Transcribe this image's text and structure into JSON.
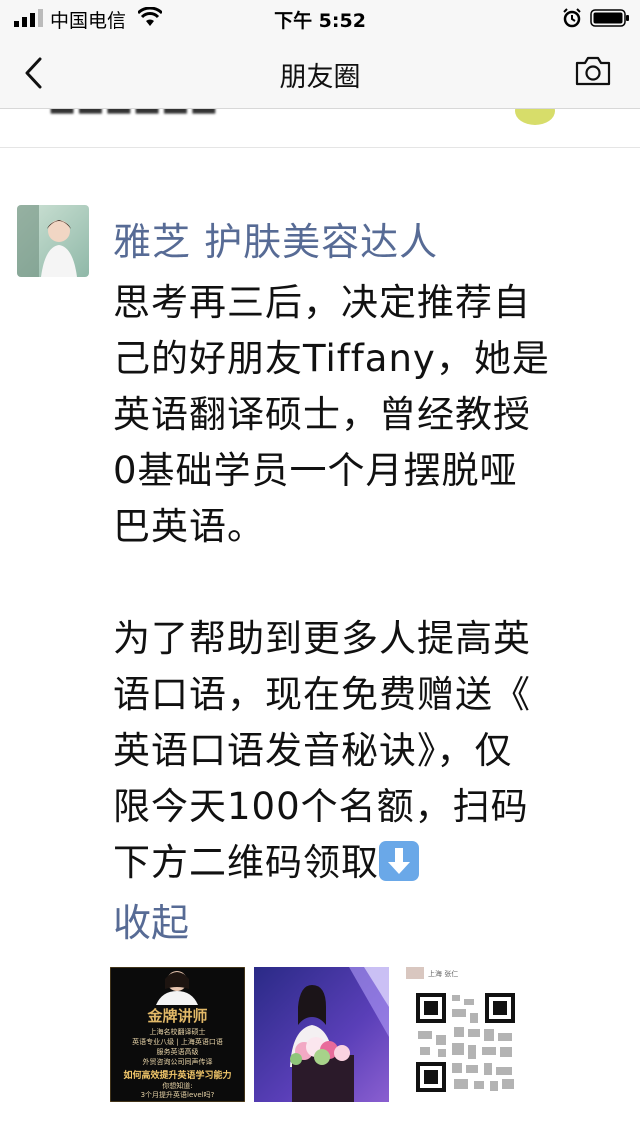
{
  "status_bar": {
    "carrier": "中国电信",
    "time": "下午 5:52",
    "icons": [
      "signal-icon",
      "wifi-icon",
      "alarm-icon",
      "battery-icon"
    ]
  },
  "nav": {
    "title": "朋友圈",
    "back_icon": "chevron-left-icon",
    "camera_icon": "camera-icon"
  },
  "post": {
    "author": "雅芝 护肤美容达人",
    "paragraph1_lines": [
      "思考再三后，决定推荐自",
      "己的好朋友Tiffany，她是",
      "英语翻译硕士，曾经教授",
      "0基础学员一个月摆脱哑",
      "巴英语。"
    ],
    "paragraph2_lines": [
      "为了帮助到更多人提高英",
      "语口语，现在免费赠送《",
      "英语口语发音秘诀》，仅",
      "限今天100个名额，扫码",
      "下方二维码领取"
    ],
    "collapse_label": "收起",
    "images": {
      "thumb1": {
        "heading": "金牌讲师",
        "line1": "上海名校翻译硕士",
        "line2": "英语专业八级 | 上海英语口语",
        "line3": "服务英语高级",
        "line4": "外贸咨询公司同声传译",
        "highlight": "如何高效提升英语学习能力",
        "line5": "你想知道:",
        "line6": "3个月提升英语level吗?"
      },
      "thumb3": {
        "label": "上海 张仁"
      }
    }
  },
  "colors": {
    "link": "#576b95",
    "nav_bg": "#f7f7f7",
    "text": "#111111"
  }
}
